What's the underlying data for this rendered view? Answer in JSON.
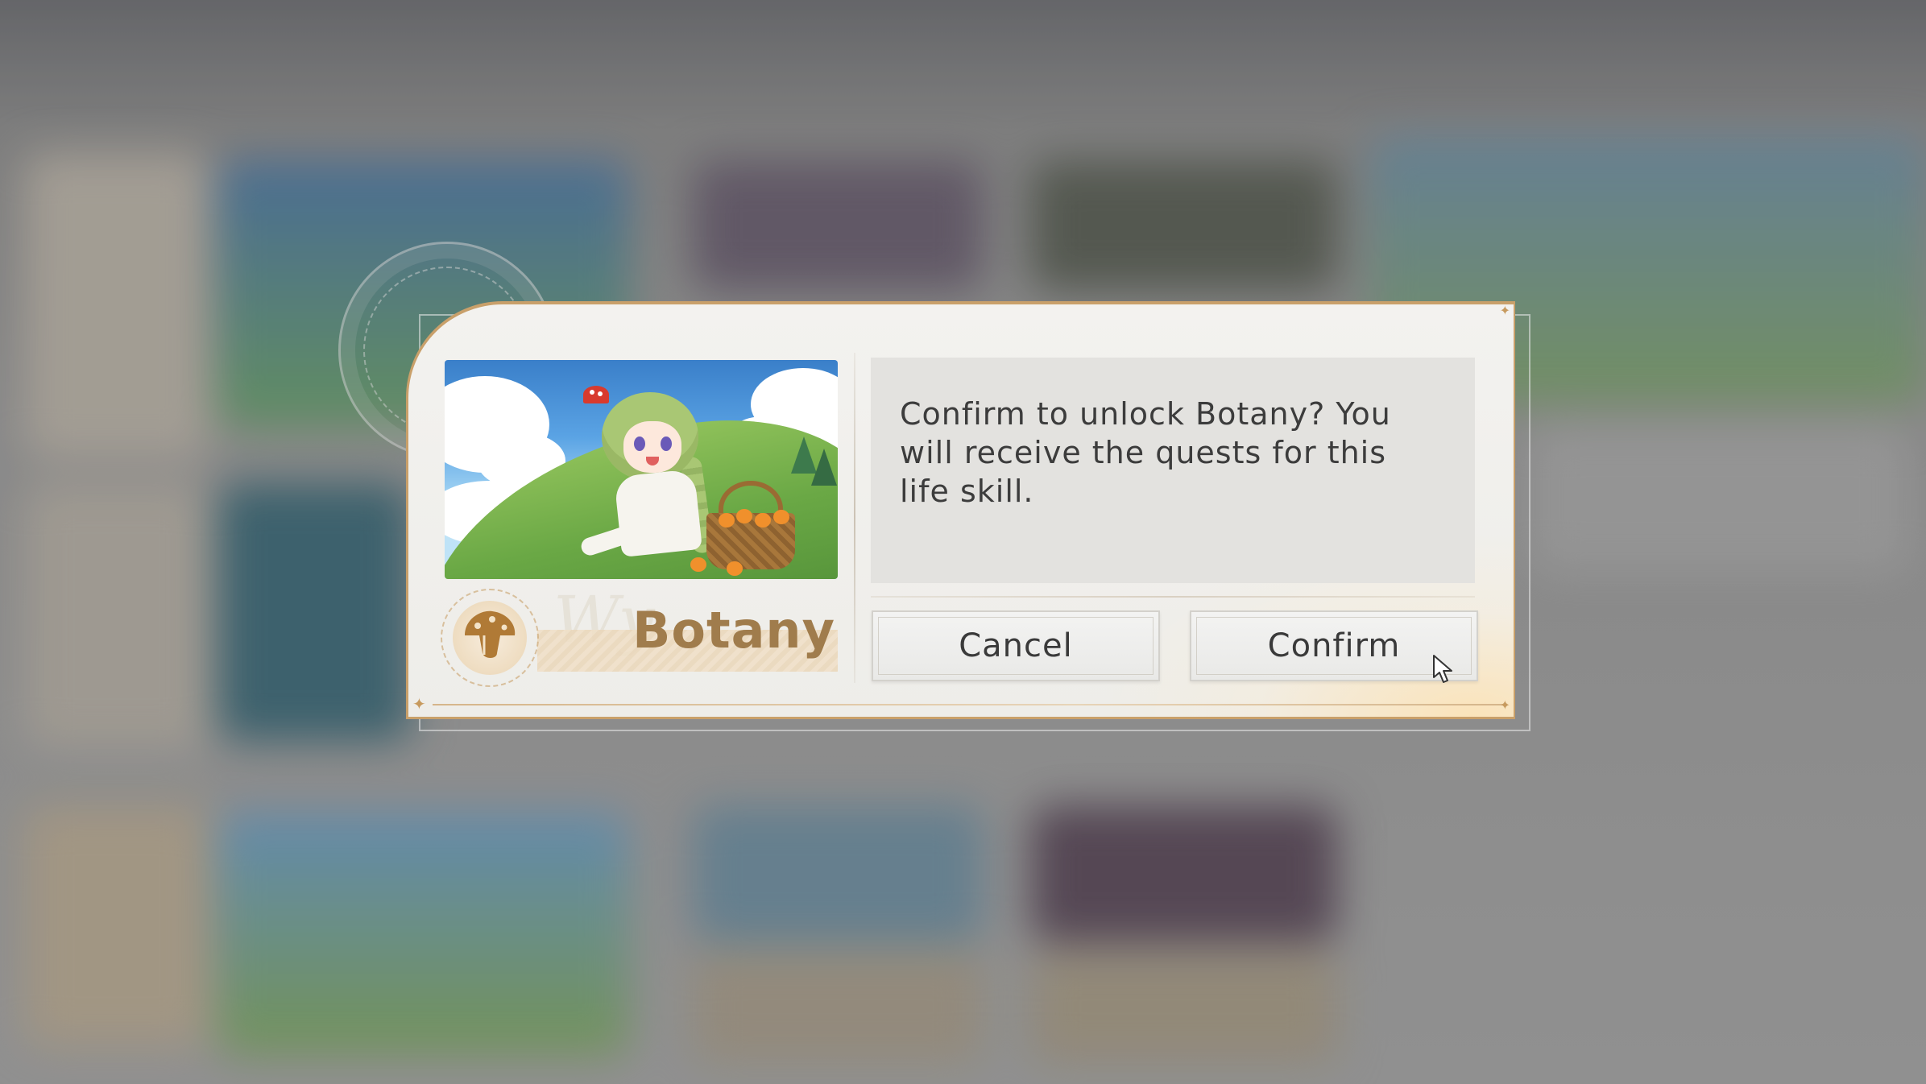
{
  "dialog": {
    "skill_name": "Botany",
    "message": "Confirm to unlock Botany? You will receive the quests for this life skill.",
    "cancel_label": "Cancel",
    "confirm_label": "Confirm",
    "skill_icon": "mushroom-icon"
  },
  "colors": {
    "accent_gold": "#c9a06a",
    "skill_text": "#a07c4c",
    "message_text": "#3c3c3c",
    "button_text": "#3a3a3a"
  }
}
